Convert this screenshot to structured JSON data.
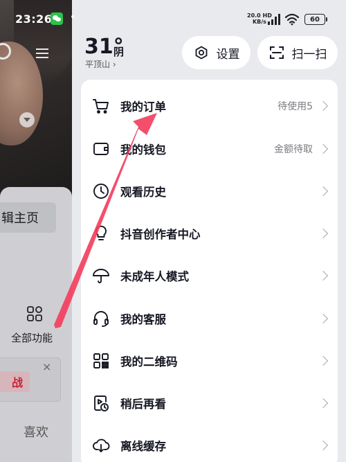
{
  "status_bar": {
    "time": "23:26",
    "dot": "•",
    "net_speed_value": "20.0",
    "net_speed_unit": "KB/s",
    "network": "HD",
    "battery": "60"
  },
  "background": {
    "edit_profile_label": "辑主页",
    "all_functions_label": "全部功能",
    "challenge_tag": "战",
    "close_symbol": "×",
    "like_label": "喜欢"
  },
  "header": {
    "temperature": "31°",
    "condition": "阴",
    "city": "平顶山 ›",
    "settings_label": "设置",
    "scan_label": "扫一扫"
  },
  "menu": {
    "items": [
      {
        "icon": "shopping-cart-icon",
        "label": "我的订单",
        "hint": "待使用5"
      },
      {
        "icon": "wallet-icon",
        "label": "我的钱包",
        "hint": "金额待取"
      },
      {
        "icon": "clock-icon",
        "label": "观看历史",
        "hint": ""
      },
      {
        "icon": "lightbulb-icon",
        "label": "抖音创作者中心",
        "hint": ""
      },
      {
        "icon": "umbrella-icon",
        "label": "未成年人模式",
        "hint": ""
      },
      {
        "icon": "headset-icon",
        "label": "我的客服",
        "hint": ""
      },
      {
        "icon": "qr-code-icon",
        "label": "我的二维码",
        "hint": ""
      },
      {
        "icon": "watch-later-icon",
        "label": "稍后再看",
        "hint": ""
      },
      {
        "icon": "download-cloud-icon",
        "label": "离线缓存",
        "hint": ""
      }
    ]
  },
  "colors": {
    "annotation_arrow": "#f2405f",
    "wechat": "#2cc24b",
    "text_primary": "#161823"
  }
}
